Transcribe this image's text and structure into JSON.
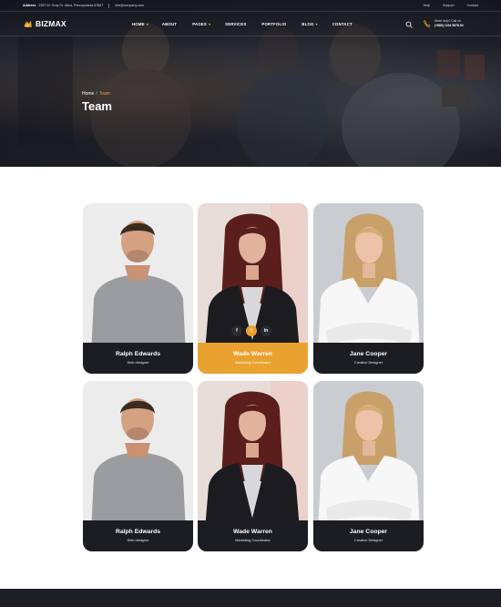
{
  "topbar": {
    "address_label": "Address",
    "address": "3357 W. Gray St. Utica, Pennsylvania 57867",
    "email": "info@company.com",
    "links": [
      "Help",
      "Support",
      "Contact"
    ]
  },
  "logo": {
    "text": "BIZMAX"
  },
  "nav": {
    "items": [
      {
        "label": "HOME",
        "dropdown": true
      },
      {
        "label": "ABOUT",
        "dropdown": false
      },
      {
        "label": "PAGES",
        "dropdown": true
      },
      {
        "label": "SERVICES",
        "dropdown": false
      },
      {
        "label": "PORTFOLIO",
        "dropdown": false
      },
      {
        "label": "BLOG",
        "dropdown": true
      },
      {
        "label": "CONTACT",
        "dropdown": false
      }
    ]
  },
  "help": {
    "label": "Need help? Call us:",
    "phone": "(+880) 1234 5678 90"
  },
  "hero": {
    "crumb_home": "Home",
    "crumb_current": "Team",
    "title": "Team"
  },
  "team": [
    {
      "name": "Ralph Edwards",
      "role": "Web designer",
      "style": "man"
    },
    {
      "name": "Wade Warren",
      "role": "Marketing Coordinator",
      "style": "woman",
      "active": true
    },
    {
      "name": "Jane Cooper",
      "role": "Creative Designer",
      "style": "blonde"
    },
    {
      "name": "Ralph Edwards",
      "role": "Web designer",
      "style": "man"
    },
    {
      "name": "Wade Warren",
      "role": "Marketing Coordinator",
      "style": "woman"
    },
    {
      "name": "Jane Cooper",
      "role": "Creative Designer",
      "style": "blonde"
    }
  ],
  "socials": [
    "f",
    "t",
    "in"
  ],
  "colors": {
    "accent": "#e9a230",
    "dark": "#1c1d22"
  }
}
